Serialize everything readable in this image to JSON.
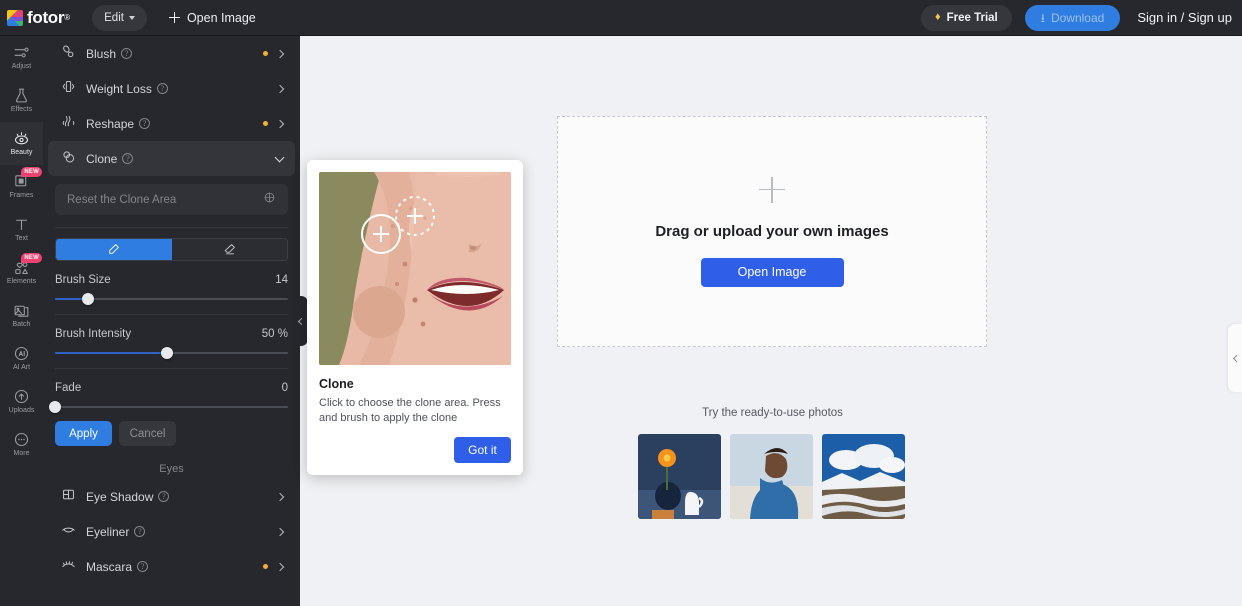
{
  "header": {
    "logo_text": "fotor",
    "logo_reg": "®",
    "edit_label": "Edit",
    "open_image_label": "Open Image",
    "free_trial_label": "Free Trial",
    "download_label": "Download",
    "signin_label": "Sign in / Sign up",
    "accent": "#2f7de1"
  },
  "rail": {
    "items": [
      {
        "label": "Adjust",
        "icon": "sliders-icon",
        "active": false,
        "badge": ""
      },
      {
        "label": "Effects",
        "icon": "flask-icon",
        "active": false,
        "badge": ""
      },
      {
        "label": "Beauty",
        "icon": "eye-sparkle-icon",
        "active": true,
        "badge": ""
      },
      {
        "label": "Frames",
        "icon": "frame-icon",
        "active": false,
        "badge": "NEW"
      },
      {
        "label": "Text",
        "icon": "text-icon",
        "active": false,
        "badge": ""
      },
      {
        "label": "Elements",
        "icon": "shapes-icon",
        "active": false,
        "badge": "NEW"
      },
      {
        "label": "Batch",
        "icon": "batch-images-icon",
        "active": false,
        "badge": ""
      },
      {
        "label": "AI Art",
        "icon": "ai-art-icon",
        "active": false,
        "badge": ""
      },
      {
        "label": "Uploads",
        "icon": "upload-cloud-icon",
        "active": false,
        "badge": ""
      },
      {
        "label": "More",
        "icon": "more-dots-icon",
        "active": false,
        "badge": ""
      }
    ]
  },
  "panel": {
    "rows_top": [
      {
        "label": "Blush",
        "icon": "blush-icon",
        "dot": true,
        "state": "collapsed"
      },
      {
        "label": "Weight Loss",
        "icon": "weight-loss-icon",
        "dot": false,
        "state": "collapsed"
      },
      {
        "label": "Reshape",
        "icon": "reshape-icon",
        "dot": true,
        "state": "collapsed"
      },
      {
        "label": "Clone",
        "icon": "clone-icon",
        "dot": false,
        "state": "expanded"
      }
    ],
    "clone": {
      "reset_label": "Reset the Clone Area",
      "reset_icon": "reset-target-icon",
      "tools": [
        {
          "icon": "brush-pencil-icon",
          "selected": true
        },
        {
          "icon": "eraser-icon",
          "selected": false
        }
      ],
      "sliders": [
        {
          "label": "Brush Size",
          "value": "14",
          "percent": 14
        },
        {
          "label": "Brush Intensity",
          "value": "50 %",
          "percent": 48
        },
        {
          "label": "Fade",
          "value": "0",
          "percent": 0
        }
      ],
      "apply_label": "Apply",
      "cancel_label": "Cancel"
    },
    "eyes_group_title": "Eyes",
    "rows_eyes": [
      {
        "label": "Eye Shadow",
        "icon": "eye-shadow-icon",
        "dot": false,
        "state": "collapsed"
      },
      {
        "label": "Eyeliner",
        "icon": "eyeliner-icon",
        "dot": false,
        "state": "collapsed"
      },
      {
        "label": "Mascara",
        "icon": "mascara-icon",
        "dot": true,
        "state": "collapsed"
      }
    ],
    "collapse_handle_icon": "chevron-left-icon"
  },
  "canvas": {
    "dropzone": {
      "plus_icon": "plus-icon",
      "title": "Drag or upload your own images",
      "button_label": "Open Image"
    },
    "ready_title": "Try the ready-to-use photos",
    "thumbs": [
      {
        "name": "flower-vase-photo"
      },
      {
        "name": "man-blue-hoodie-photo"
      },
      {
        "name": "snowy-mountain-photo"
      }
    ],
    "collapse_handle_icon": "chevron-left-icon",
    "background": "#f0f1f4"
  },
  "tipcard": {
    "image_name": "clone-demo-face-photo",
    "title": "Clone",
    "body": "Click to choose the clone area. Press and brush to apply the clone",
    "button_label": "Got it"
  }
}
